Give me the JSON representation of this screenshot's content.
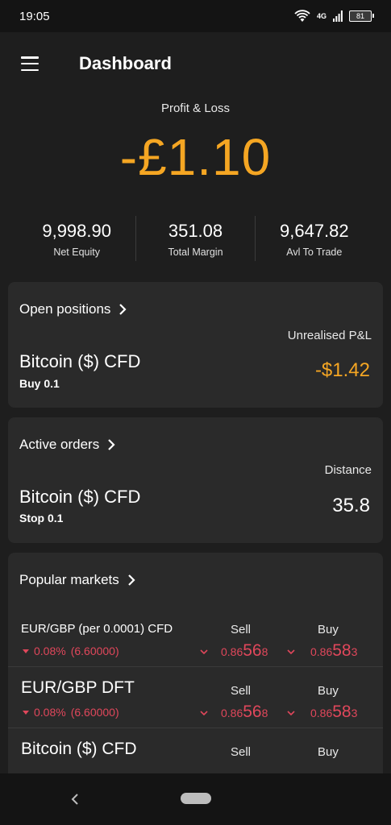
{
  "status": {
    "time": "19:05",
    "network": "4G",
    "battery": "81"
  },
  "header": {
    "title": "Dashboard"
  },
  "pnl": {
    "label": "Profit & Loss",
    "value": "-£1.10"
  },
  "stats": [
    {
      "value": "9,998.90",
      "label": "Net Equity"
    },
    {
      "value": "351.08",
      "label": "Total Margin"
    },
    {
      "value": "9,647.82",
      "label": "Avl To Trade"
    }
  ],
  "open_positions": {
    "title": "Open positions",
    "column_label": "Unrealised P&L",
    "instrument": "Bitcoin ($) CFD",
    "detail": "Buy  0.1",
    "value": "-$1.42"
  },
  "active_orders": {
    "title": "Active orders",
    "column_label": "Distance",
    "instrument": "Bitcoin ($) CFD",
    "detail": "Stop  0.1",
    "value": "35.8"
  },
  "popular_markets": {
    "title": "Popular markets",
    "rows": [
      {
        "name": "EUR/GBP (per 0.0001) CFD",
        "change_pct": "0.08%",
        "change_abs": "(6.60000)",
        "sell_label": "Sell",
        "buy_label": "Buy",
        "sell": {
          "pre": "0.86",
          "big": "56",
          "post": "8"
        },
        "buy": {
          "pre": "0.86",
          "big": "58",
          "post": "3"
        }
      },
      {
        "name": "EUR/GBP DFT",
        "change_pct": "0.08%",
        "change_abs": "(6.60000)",
        "sell_label": "Sell",
        "buy_label": "Buy",
        "sell": {
          "pre": "0.86",
          "big": "56",
          "post": "8"
        },
        "buy": {
          "pre": "0.86",
          "big": "58",
          "post": "3"
        }
      },
      {
        "name": "Bitcoin ($) CFD",
        "sell_label": "Sell",
        "buy_label": "Buy"
      }
    ]
  },
  "colors": {
    "accent": "#f5a623",
    "negative": "#e0475b",
    "card": "#2a2a2a",
    "background": "#1e1e1e"
  },
  "icons": {
    "menu": "hamburger-icon",
    "chevron": "chevron-right-icon",
    "back": "back-icon"
  }
}
